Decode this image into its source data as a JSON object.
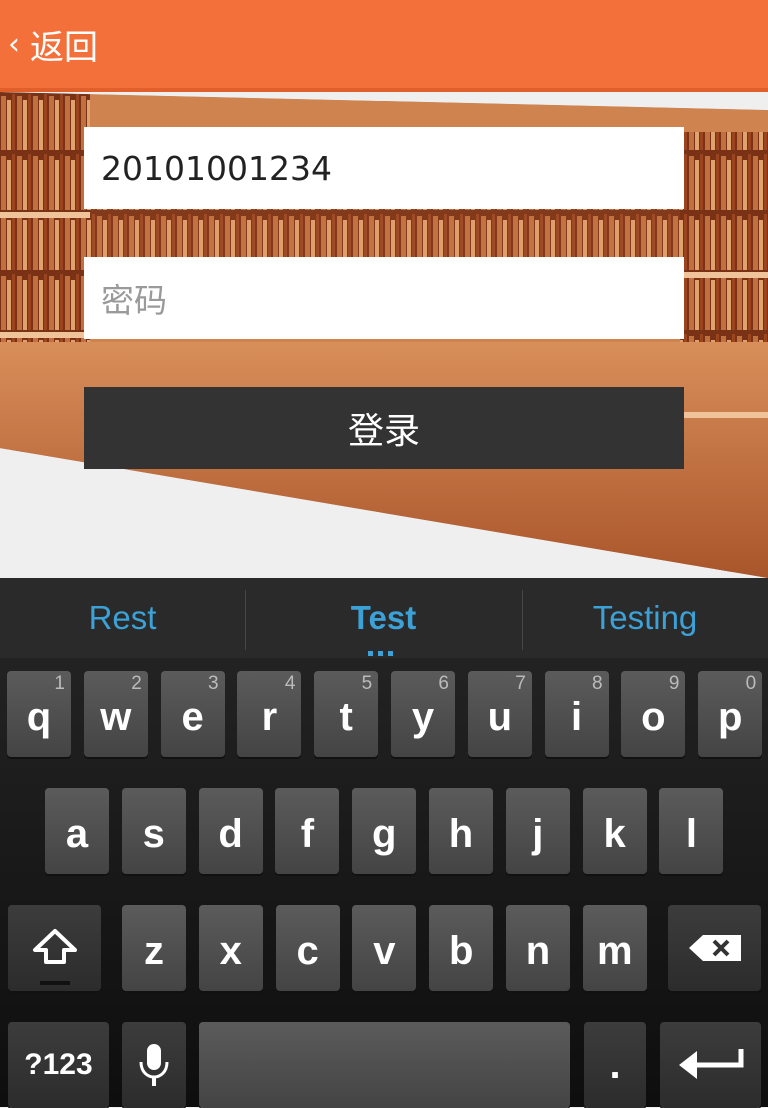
{
  "header": {
    "back_label": "返回",
    "back_icon": "‹"
  },
  "form": {
    "username_value": "20101001234",
    "password_placeholder": "密码",
    "login_label": "登录"
  },
  "keyboard": {
    "suggestions": [
      "Rest",
      "Test",
      "Testing"
    ],
    "row1": [
      {
        "k": "q",
        "n": "1"
      },
      {
        "k": "w",
        "n": "2"
      },
      {
        "k": "e",
        "n": "3"
      },
      {
        "k": "r",
        "n": "4"
      },
      {
        "k": "t",
        "n": "5"
      },
      {
        "k": "y",
        "n": "6"
      },
      {
        "k": "u",
        "n": "7"
      },
      {
        "k": "i",
        "n": "8"
      },
      {
        "k": "o",
        "n": "9"
      },
      {
        "k": "p",
        "n": "0"
      }
    ],
    "row2": [
      "a",
      "s",
      "d",
      "f",
      "g",
      "h",
      "j",
      "k",
      "l"
    ],
    "row3": [
      "z",
      "x",
      "c",
      "v",
      "b",
      "n",
      "m"
    ],
    "symbols_label": "?123",
    "period_label": "."
  },
  "colors": {
    "accent": "#f3703a",
    "suggestion": "#3ba1d6",
    "button": "#333333"
  }
}
